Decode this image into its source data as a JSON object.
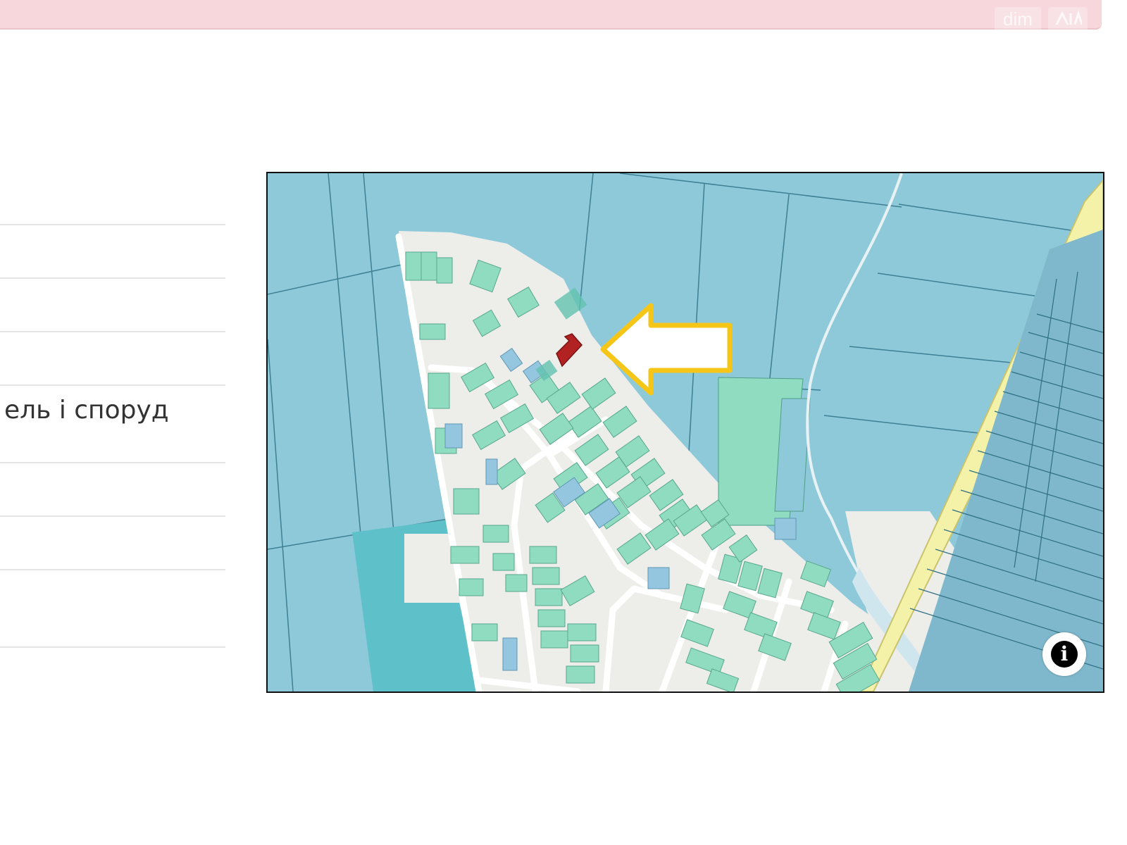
{
  "banner": {
    "color": "#f7d6dc",
    "watermark_text": "dim",
    "watermark_logo": "ria-logo-icon"
  },
  "left_list": {
    "visible_item_text": "ель і споруд"
  },
  "map": {
    "colors": {
      "field": "#8ec9da",
      "road_area": "#ededea",
      "parcel": "#8fdcc0",
      "parcel_blue": "#94c6e0",
      "teal_block": "#5ec1c9",
      "highlight": "#b22222",
      "pointer_arrow": "#f5c518",
      "highway": "#f4f1a8"
    },
    "pointer_icon": "arrow-left-icon",
    "info_icon": "info-icon"
  }
}
